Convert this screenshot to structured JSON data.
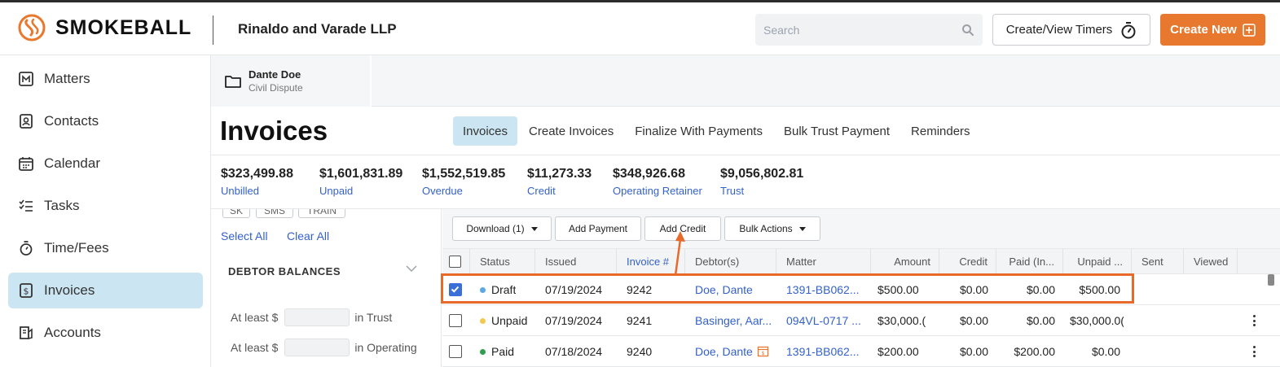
{
  "brand": {
    "name": "SMOKEBALL",
    "accent": "#e8782d"
  },
  "header": {
    "firm": "Rinaldo and Varade LLP",
    "search_placeholder": "Search",
    "timers_label": "Create/View Timers",
    "create_label": "Create New"
  },
  "sidebar": {
    "items": [
      {
        "label": "Matters",
        "icon": "matters-icon"
      },
      {
        "label": "Contacts",
        "icon": "contacts-icon"
      },
      {
        "label": "Calendar",
        "icon": "calendar-icon"
      },
      {
        "label": "Tasks",
        "icon": "tasks-icon"
      },
      {
        "label": "Time/Fees",
        "icon": "stopwatch-icon"
      },
      {
        "label": "Invoices",
        "icon": "invoice-icon",
        "active": true
      },
      {
        "label": "Accounts",
        "icon": "accounts-icon"
      }
    ]
  },
  "matter": {
    "name": "Dante Doe",
    "type": "Civil Dispute"
  },
  "page": {
    "title": "Invoices",
    "tabs": [
      "Invoices",
      "Create Invoices",
      "Finalize With Payments",
      "Bulk Trust Payment",
      "Reminders"
    ],
    "active_tab": "Invoices"
  },
  "totals": [
    {
      "value": "$323,499.88",
      "label": "Unbilled"
    },
    {
      "value": "$1,601,831.89",
      "label": "Unpaid"
    },
    {
      "value": "$1,552,519.85",
      "label": "Overdue"
    },
    {
      "value": "$11,273.33",
      "label": "Credit"
    },
    {
      "value": "$348,926.68",
      "label": "Operating Retainer"
    },
    {
      "value": "$9,056,802.81",
      "label": "Trust"
    }
  ],
  "filters": {
    "chips": [
      "SK",
      "SMS",
      "TRAIN"
    ],
    "select_all": "Select All",
    "clear_all": "Clear All",
    "section": "DEBTOR BALANCES",
    "rows": [
      {
        "prefix": "At least $",
        "suffix": "in Trust"
      },
      {
        "prefix": "At least $",
        "suffix": "in Operating"
      }
    ]
  },
  "toolbar": {
    "download": "Download (1)",
    "add_payment": "Add Payment",
    "add_credit": "Add Credit",
    "bulk_actions": "Bulk Actions"
  },
  "table": {
    "columns": [
      "Status",
      "Issued",
      "Invoice #",
      "Debtor(s)",
      "Matter",
      "Amount",
      "Credit",
      "Paid (In...",
      "Unpaid ...",
      "Sent",
      "Viewed"
    ],
    "rows": [
      {
        "checked": true,
        "status": "Draft",
        "status_color": "#5aa9e6",
        "issued": "07/19/2024",
        "invoice": "9242",
        "debtor": "Doe, Dante",
        "matter": "1391-BB062...",
        "amount": "$500.00",
        "credit": "$0.00",
        "paid": "$0.00",
        "unpaid": "$500.00"
      },
      {
        "checked": false,
        "status": "Unpaid",
        "status_color": "#f2c94c",
        "issued": "07/19/2024",
        "invoice": "9241",
        "debtor": "Basinger, Aar...",
        "matter": "094VL-0717 ...",
        "amount": "$30,000.(",
        "credit": "$0.00",
        "paid": "$0.00",
        "unpaid": "$30,000.0("
      },
      {
        "checked": false,
        "status": "Paid",
        "status_color": "#2e9e4f",
        "issued": "07/18/2024",
        "invoice": "9240",
        "debtor": "Doe, Dante",
        "matter": "1391-BB062...",
        "amount": "$200.00",
        "credit": "$0.00",
        "paid": "$200.00",
        "unpaid": "$0.00"
      }
    ]
  },
  "annotation": {
    "color": "#e8692a"
  }
}
